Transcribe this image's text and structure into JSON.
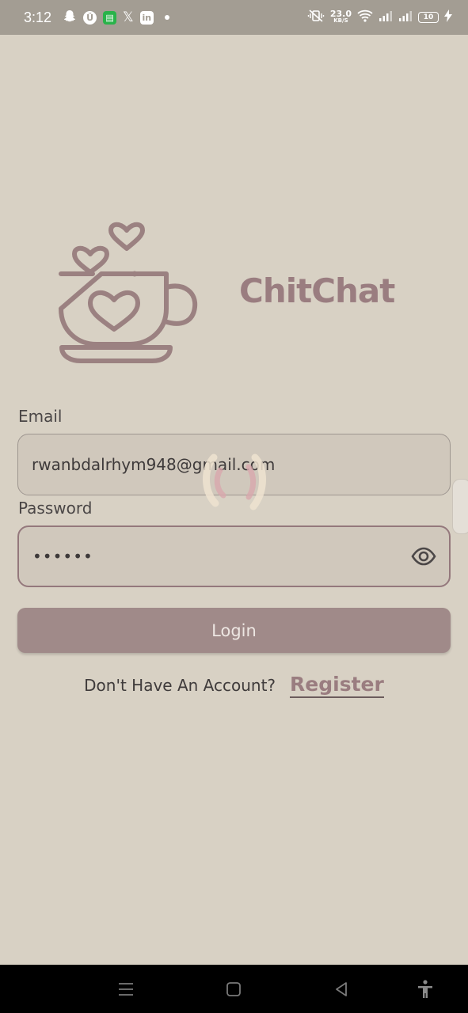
{
  "status_bar": {
    "time": "3:12",
    "speed_value": "23.0",
    "speed_unit": "KB/S",
    "battery": "10"
  },
  "app": {
    "name": "ChitChat"
  },
  "form": {
    "email_label": "Email",
    "email_value": "rwanbdalrhym948@gmail.com",
    "password_label": "Password",
    "password_value": "••••••",
    "login_label": "Login",
    "register_prompt": "Don't Have An Account?",
    "register_label": "Register"
  },
  "colors": {
    "background": "#d8d1c4",
    "accent": "#9a7d80",
    "button": "#a08a89"
  }
}
